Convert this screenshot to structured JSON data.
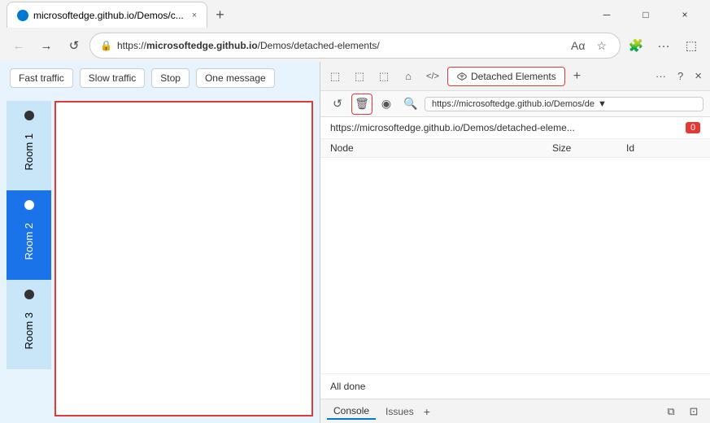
{
  "browser": {
    "tab": {
      "favicon": "circle",
      "label": "microsoftedge.github.io/Demos/c...",
      "close": "×"
    },
    "new_tab": "+",
    "window_controls": {
      "minimize": "─",
      "maximize": "□",
      "close": "×"
    }
  },
  "navbar": {
    "back": "←",
    "forward": "→",
    "refresh": "↺",
    "address": "https://microsoftedge.github.io/Demos/detached-elements/",
    "address_display": "https://microsoftedge.github.io/Demos/detached-elements/",
    "read_aloud": "A",
    "favorites": "☆",
    "extensions": "🧩",
    "more": "..."
  },
  "webpage": {
    "toolbar": {
      "fast_traffic": "Fast traffic",
      "slow_traffic": "Slow traffic",
      "stop": "Stop",
      "one_message": "One message"
    },
    "rooms": [
      {
        "label": "Room 1",
        "active": false
      },
      {
        "label": "Room 2",
        "active": true
      },
      {
        "label": "Room 3",
        "active": false
      }
    ]
  },
  "devtools": {
    "tabs": {
      "icon1": "⬚",
      "icon2": "⬚",
      "icon3": "⬚",
      "icon4": "⌂",
      "icon5": "</>",
      "active_tab": "Detached Elements",
      "plus": "+",
      "overflow": "...",
      "help": "?",
      "close": "×"
    },
    "toolbar": {
      "refresh": "↺",
      "trash": "🗑",
      "eye": "◉",
      "search": "🔍",
      "address": "https://microsoftedge.github.io/Demos/de",
      "dropdown": "▼"
    },
    "content": {
      "url": "https://microsoftedge.github.io/Demos/detached-eleme...",
      "badge": "0",
      "columns": {
        "node": "Node",
        "size": "Size",
        "id": "Id"
      },
      "status": "All done"
    },
    "console_bar": {
      "console": "Console",
      "issues": "Issues",
      "plus": "+",
      "btn1": "⧉",
      "btn2": "⊡"
    }
  }
}
